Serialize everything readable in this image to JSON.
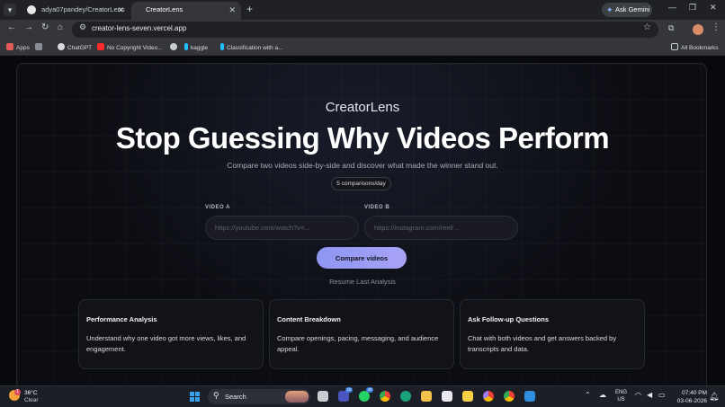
{
  "browser": {
    "tabs": [
      {
        "title": "adya07pandey/CreatorLens",
        "active": false
      },
      {
        "title": "CreatorLens",
        "active": true
      }
    ],
    "new_tab_icon": "+",
    "gemini_label": "Ask Gemini",
    "url": "creator-lens-seven.vercel.app",
    "bookmarks": [
      "Apps",
      "ChatGPT",
      "No Copyright Video...",
      "kaggle",
      "Classification with a...",
      "All Bookmarks"
    ]
  },
  "page": {
    "brand": "CreatorLens",
    "headline": "Stop Guessing Why Videos Perform",
    "subhead": "Compare two videos side-by-side and discover what made the winner stand out.",
    "limit_pill": "5 comparisons/day",
    "video_a": {
      "label": "VIDEO A",
      "placeholder": "https://youtube.com/watch?v=...",
      "value": ""
    },
    "video_b": {
      "label": "VIDEO B",
      "placeholder": "https://instagram.com/reel/...",
      "value": ""
    },
    "compare_button": "Compare videos",
    "resume_link": "Resume Last Analysis",
    "features": [
      {
        "title": "Performance Analysis",
        "body": "Understand why one video got more views, likes, and engagement."
      },
      {
        "title": "Content Breakdown",
        "body": "Compare openings, pacing, messaging, and audience appeal."
      },
      {
        "title": "Ask Follow-up Questions",
        "body": "Chat with both videos and get answers backed by transcripts and data."
      }
    ]
  },
  "taskbar": {
    "weather": {
      "temp": "36°C",
      "condition": "Clear",
      "badge": "1"
    },
    "search_label": "Search",
    "badges": {
      "teams": "10",
      "whatsapp": "40"
    },
    "lang": {
      "line1": "ENG",
      "line2": "US"
    },
    "clock": {
      "time": "07:40 PM",
      "date": "03-06-2026"
    }
  },
  "colors": {
    "accent": "#8e96f2",
    "background": "#0c0d12"
  }
}
